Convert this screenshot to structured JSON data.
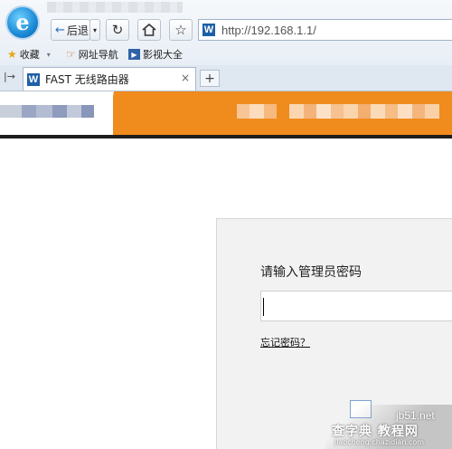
{
  "browser": {
    "nav": {
      "back_label": "后退",
      "back_arrow": "←",
      "dropdown": "▾",
      "refresh": "↻",
      "favorite": "☆"
    },
    "address": {
      "site_icon_letter": "W",
      "url": "http://192.168.1.1/"
    },
    "favorites_bar": {
      "items": [
        {
          "label": "收藏",
          "icon": "star-folder-icon"
        },
        {
          "label": "网址导航",
          "icon": "nav-hand-icon"
        },
        {
          "label": "影视大全",
          "icon": "video-icon"
        }
      ]
    },
    "tabs": [
      {
        "title": "FAST 无线路由器",
        "icon_letter": "W",
        "close": "×"
      }
    ],
    "new_tab": "+",
    "tab_scroll": "|→"
  },
  "page": {
    "banner_color": "#f08b1d",
    "login": {
      "prompt": "请输入管理员密码",
      "password_value": "",
      "forgot_link": "忘记密码？"
    }
  },
  "watermark": {
    "site": "jb51.net",
    "main": "查字典 教程网",
    "sub": "jiaocheng.chazidian.com"
  }
}
